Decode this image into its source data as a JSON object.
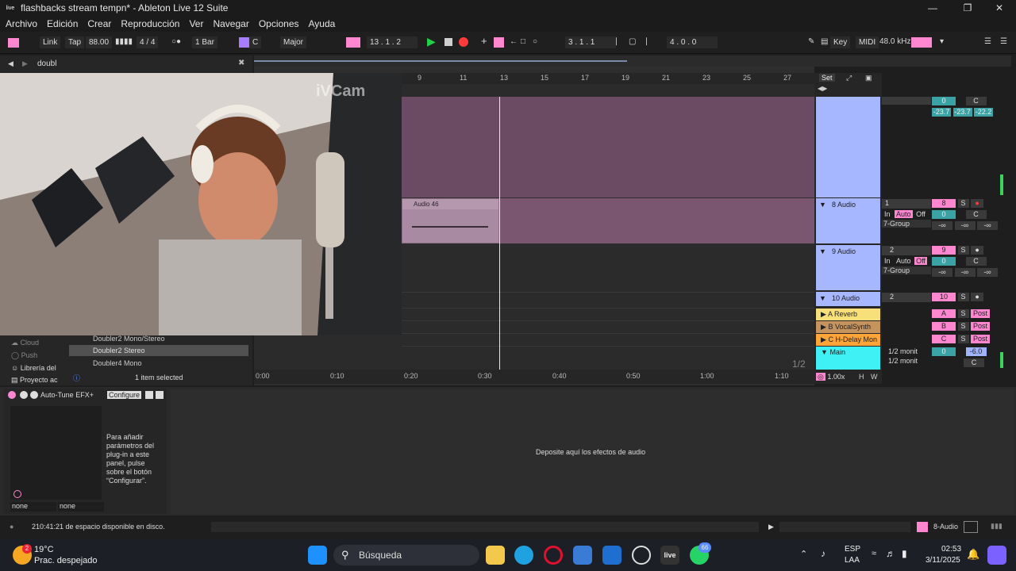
{
  "window": {
    "title": "flashbacks  stream tempn* - Ableton Live 12 Suite",
    "app_icon": "live"
  },
  "menu": [
    "Archivo",
    "Edición",
    "Crear",
    "Reproducción",
    "Ver",
    "Navegar",
    "Opciones",
    "Ayuda"
  ],
  "transport": {
    "link": "Link",
    "tap": "Tap",
    "tempo": "88.00",
    "signature": "4 / 4",
    "quantize": "1 Bar",
    "key": "C",
    "scale": "Major",
    "position": "13 .  1 .  2",
    "loop_start": "3 .  1 .  1",
    "loop_length": "4 .  0 .  0",
    "key_label": "Key",
    "midi_label": "MIDI",
    "sample_rate": "48.0 kHz"
  },
  "browser": {
    "search_value": "doubl",
    "places": [
      "Cloud",
      "Push",
      "Librería del",
      "Proyecto ac"
    ],
    "items": [
      "Doubler2 Mono/Stereo",
      "Doubler2 Stereo",
      "Doubler4 Mono"
    ],
    "selected_item": "Doubler2 Stereo",
    "selection_status": "1 item selected"
  },
  "arrangement": {
    "bars": [
      "9",
      "11",
      "13",
      "15",
      "17",
      "19",
      "21",
      "23",
      "25",
      "27"
    ],
    "times": [
      "0:00",
      "0:10",
      "0:20",
      "0:30",
      "0:40",
      "0:50",
      "1:00",
      "1:10"
    ],
    "clip_name": "Audio 46",
    "page": "1/2",
    "zoom": "1.00x",
    "set_label": "Set",
    "h_label": "H",
    "w_label": "W"
  },
  "tracks": [
    {
      "name": "8 Audio",
      "input": "1",
      "in_label": "In",
      "auto_label": "Auto",
      "off_label": "Off",
      "group": "7-Group",
      "number": "8",
      "solo": "S",
      "pan": "C",
      "vol_l": "-∞",
      "vol_r": "-∞",
      "vol_m": "-∞"
    },
    {
      "name": "9 Audio",
      "input": "2",
      "in_label": "In",
      "auto_label": "Auto",
      "off_label": "Off",
      "group": "7-Group",
      "number": "9",
      "solo": "S",
      "pan": "C",
      "vol_l": "-∞",
      "vol_r": "-∞",
      "vol_m": "-∞"
    },
    {
      "name": "10 Audio",
      "input": "2",
      "number": "10",
      "solo": "S"
    }
  ],
  "top_strip": {
    "value": "0",
    "pan": "C",
    "meters": [
      "-23.7",
      "-23.7",
      "-22.2"
    ]
  },
  "returns": [
    {
      "name": "A Reverb",
      "letter": "A",
      "solo": "S",
      "post": "Post",
      "color": "#f7e07a"
    },
    {
      "name": "B VocalSynth",
      "letter": "B",
      "solo": "S",
      "post": "Post",
      "color": "#c5935e"
    },
    {
      "name": "C H-Delay Mon",
      "letter": "C",
      "solo": "S",
      "post": "Post",
      "color": "#ffa436"
    }
  ],
  "main": {
    "name": "Main",
    "out1": "1/2 monit",
    "out2": "1/2 monit",
    "value": "0",
    "level": "-6.0",
    "pan": "C",
    "color": "#3ff1f4"
  },
  "device": {
    "name": "Auto-Tune EFX+",
    "configure": "Configure",
    "help_text": "Para añadir parámetros del plug-in a este panel, pulse sobre el botón “Configurar”.",
    "select_left": "none",
    "select_right": "none",
    "drop_hint": "Deposite aquí los efectos de audio"
  },
  "status": {
    "disk": "210:41:21 de espacio disponible en disco.",
    "track": "8-Audio"
  },
  "webcam": {
    "watermark": "iVCam"
  },
  "taskbar": {
    "weather_temp": "19°C",
    "weather_desc": "Prac. despejado",
    "weather_badge": "2",
    "search_placeholder": "Búsqueda",
    "lang1": "ESP",
    "lang2": "LAA",
    "time": "02:53",
    "date": "3/11/2025",
    "whatsapp_badge": "66",
    "live_label": "live"
  },
  "colors": {
    "accent_pink": "#ff86cf",
    "track_blue": "#a7b7ff",
    "teal": "#3ba3a6",
    "play_green": "#22d04a",
    "record_red": "#ff3b3b"
  }
}
